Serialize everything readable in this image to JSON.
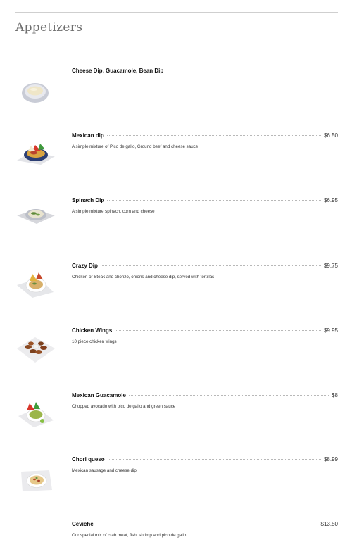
{
  "section": {
    "title": "Appetizers"
  },
  "items": [
    {
      "name": "Cheese Dip, Guacamole, Bean Dip",
      "price": "",
      "description": "",
      "image_icon": "cheese-dip-bowl-icon"
    },
    {
      "name": "Mexican dip",
      "price": "$6.50",
      "description": "A simple mixture of Pico de gallo, Ground beef and cheese sauce",
      "image_icon": "mexican-dip-plate-icon"
    },
    {
      "name": "Spinach Dip",
      "price": "$6.95",
      "description": "A simple mixture spinach, corn and cheese",
      "image_icon": "spinach-dip-plate-icon"
    },
    {
      "name": "Crazy Dip",
      "price": "$9.75",
      "description": "Chicken or Steak and chorizo, onions and cheese dip, served with tortillas",
      "image_icon": "crazy-dip-plate-icon"
    },
    {
      "name": "Chicken Wings",
      "price": "$9.95",
      "description": "10 piece chicken wings",
      "image_icon": "chicken-wings-plate-icon"
    },
    {
      "name": "Mexican Guacamole",
      "price": "$8",
      "description": "Chopped avocado with pico de gallo and green sauce",
      "image_icon": "guacamole-plate-icon"
    },
    {
      "name": "Chori queso",
      "price": "$8.99",
      "description": "Mexican sausage and cheese dip",
      "image_icon": "chori-queso-plate-icon"
    },
    {
      "name": "Ceviche",
      "price": "$13.50",
      "description": "Our special mix of crab meat, fish, shrimp and pico de gallo",
      "image_icon": "ceviche-icon"
    }
  ]
}
